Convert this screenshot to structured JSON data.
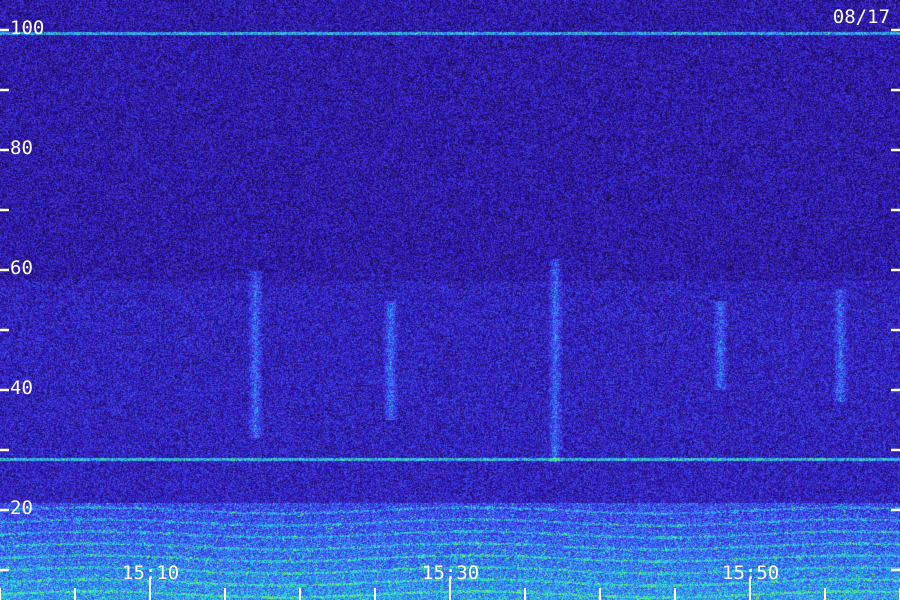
{
  "date_label": "08/17",
  "chart_data": {
    "type": "heatmap",
    "title": "",
    "xlabel": "",
    "ylabel": "",
    "y_ticks_labeled": [
      20,
      40,
      60,
      80,
      100
    ],
    "y_ticks_minor": [
      10,
      30,
      50,
      70,
      90
    ],
    "ylim": [
      5,
      105
    ],
    "x_ticks_labeled": [
      "15:10",
      "15:30",
      "15:50"
    ],
    "x_minor_per_major": 4,
    "colormap": [
      "#000000",
      "#1a0a55",
      "#3a1ed0",
      "#3f6cff",
      "#21e0d8",
      "#88ff3a"
    ],
    "features": [
      {
        "kind": "horizontal_line",
        "y": 99.5,
        "color": "#3f8cff"
      },
      {
        "kind": "horizontal_line",
        "y": 28.5,
        "color": "#3f6cff"
      },
      {
        "kind": "band",
        "y_min": 7,
        "y_max": 20,
        "color": "#21e0d8"
      },
      {
        "kind": "vertical_streak",
        "time": "15:17",
        "y_min": 32,
        "y_max": 60
      },
      {
        "kind": "vertical_streak",
        "time": "15:26",
        "y_min": 35,
        "y_max": 55
      },
      {
        "kind": "vertical_streak",
        "time": "15:37",
        "y_min": 28,
        "y_max": 62
      },
      {
        "kind": "vertical_streak",
        "time": "15:48",
        "y_min": 40,
        "y_max": 55
      },
      {
        "kind": "vertical_streak",
        "time": "15:56",
        "y_min": 38,
        "y_max": 57
      }
    ]
  }
}
